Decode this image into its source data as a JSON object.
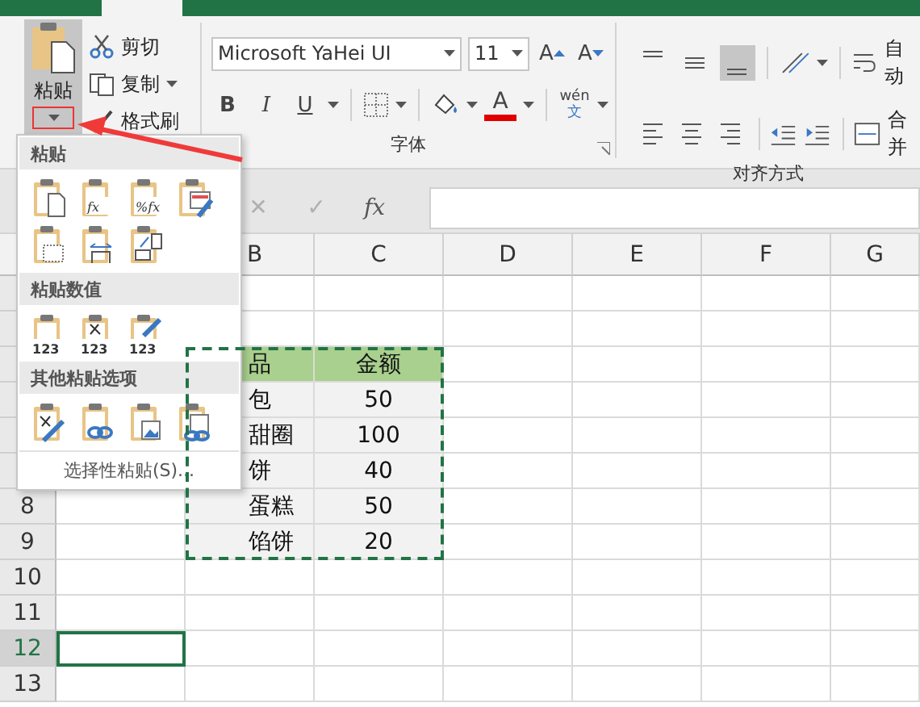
{
  "ribbon": {
    "clipboard": {
      "paste": "粘贴",
      "items": [
        {
          "kind": "cut",
          "label": "剪切",
          "dropdown": false
        },
        {
          "kind": "copy",
          "label": "复制",
          "dropdown": true
        },
        {
          "kind": "brush",
          "label": "格式刷",
          "dropdown": false
        }
      ]
    },
    "font": {
      "font_name": "Microsoft YaHei UI",
      "font_size": "11",
      "grow": "A",
      "shrink": "A",
      "format_buttons": [
        "B",
        "I",
        "U"
      ],
      "font_color": "A",
      "phonetic": "wén",
      "phonetic_char": "文",
      "label": "字体"
    },
    "alignment": {
      "vertical": [
        {
          "selected": false
        },
        {
          "selected": false
        },
        {
          "selected": true
        }
      ],
      "wrap": "自动",
      "merge": "合并",
      "label": "对齐方式"
    }
  },
  "formula_bar": {
    "cancel": "✕",
    "enter": "✓",
    "function": "fx"
  },
  "columns": [
    "B",
    "C",
    "D",
    "E",
    "F",
    "G"
  ],
  "rows": [
    {
      "kind": "plain",
      "selected": false
    },
    {
      "kind": "plain",
      "selected": false
    },
    {
      "kind": "header",
      "b": "品",
      "c": "金额",
      "selected": false
    },
    {
      "kind": "data",
      "b": "包",
      "c": "50",
      "selected": false
    },
    {
      "kind": "data",
      "b": "甜圈",
      "c": "100",
      "selected": false
    },
    {
      "kind": "data",
      "b": "饼",
      "c": "40",
      "selected": false
    },
    {
      "number": "8",
      "kind": "data",
      "b": "蛋糕",
      "c": "50",
      "selected": false
    },
    {
      "number": "9",
      "kind": "data",
      "b": "馅饼",
      "c": "20",
      "selected": false
    },
    {
      "number": "10",
      "kind": "plain",
      "selected": false
    },
    {
      "number": "11",
      "kind": "plain",
      "selected": false
    },
    {
      "number": "12",
      "kind": "plain",
      "selected": true
    },
    {
      "number": "13",
      "kind": "plain",
      "selected": false
    }
  ],
  "paste_menu": {
    "sections": [
      {
        "title": "粘贴",
        "icons": [
          {
            "kind": "paste"
          },
          {
            "kind": "formula",
            "text": "fx"
          },
          {
            "kind": "formula",
            "text": "%fx"
          },
          {
            "kind": "source-format"
          },
          {
            "kind": "no-borders"
          },
          {
            "kind": "widths"
          },
          {
            "kind": "transpose"
          }
        ]
      },
      {
        "title": "粘贴数值",
        "icons": [
          {
            "kind": "values",
            "text": "123"
          },
          {
            "kind": "values-percent",
            "text": "123"
          },
          {
            "kind": "values-brush",
            "text": "123"
          }
        ]
      },
      {
        "title": "其他粘贴选项",
        "icons": [
          {
            "kind": "formatting"
          },
          {
            "kind": "link"
          },
          {
            "kind": "picture"
          },
          {
            "kind": "linked-picture"
          }
        ]
      }
    ],
    "footer": "选择性粘贴(S)..."
  }
}
